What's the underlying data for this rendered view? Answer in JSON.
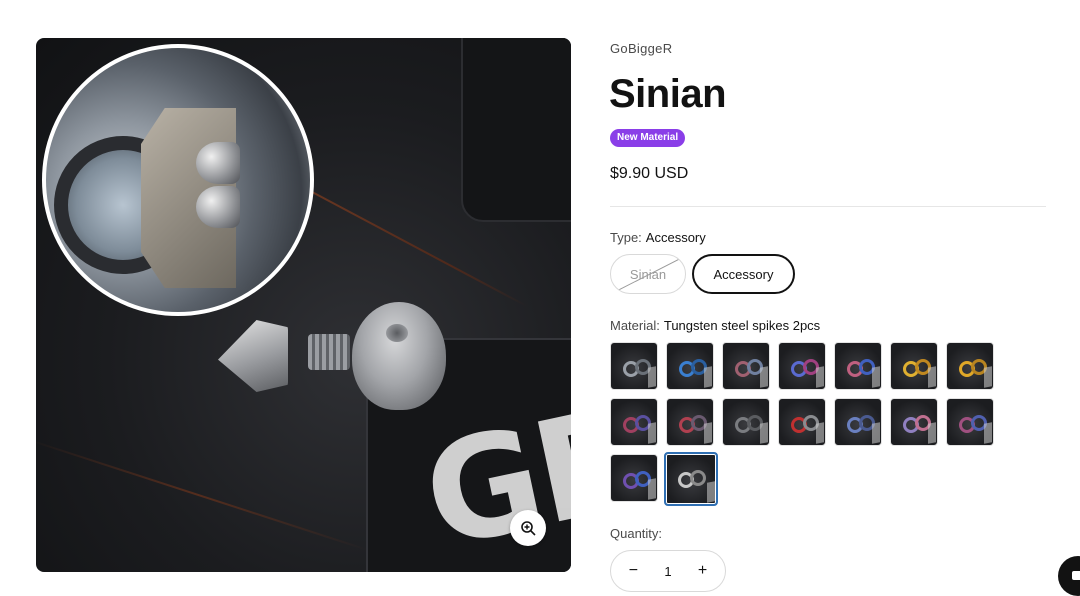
{
  "product": {
    "vendor": "GoBiggeR",
    "title": "Sinian",
    "badge": "New Material",
    "price": "$9.90 USD"
  },
  "options": {
    "type": {
      "label": "Type:",
      "selected": "Accessory",
      "values": [
        "Sinian",
        "Accessory"
      ],
      "unavailable": [
        "Sinian"
      ]
    },
    "material": {
      "label": "Material:",
      "selected": "Tungsten steel spikes 2pcs",
      "swatch_count": 16,
      "selected_index": 15
    }
  },
  "quantity": {
    "label": "Quantity:",
    "value": "1",
    "decrease_symbol": "−",
    "increase_symbol": "+"
  },
  "icons": {
    "zoom": "zoom-in-icon",
    "chat": "chat-icon"
  },
  "colors": {
    "badge": "#8a3ee8",
    "selected_swatch_border": "#2f6fb3",
    "text": "#121212"
  },
  "swatches": [
    {
      "ring": "#9aa0a8",
      "ring2": "#6a7078"
    },
    {
      "ring": "#3a7fd0",
      "ring2": "#2a5fa0"
    },
    {
      "ring": "#a06070",
      "ring2": "#7080a0"
    },
    {
      "ring": "#5a6ad0",
      "ring2": "#a04080"
    },
    {
      "ring": "#c06080",
      "ring2": "#4060c0"
    },
    {
      "ring": "#e0b030",
      "ring2": "#c08820"
    },
    {
      "ring": "#e0a828",
      "ring2": "#b88420"
    },
    {
      "ring": "#a04060",
      "ring2": "#5a50a0"
    },
    {
      "ring": "#b04050",
      "ring2": "#6a5a70"
    },
    {
      "ring": "#7a7c80",
      "ring2": "#5a5c60"
    },
    {
      "ring": "#c03030",
      "ring2": "#8a8c90"
    },
    {
      "ring": "#6a80c0",
      "ring2": "#4a5a90"
    },
    {
      "ring": "#9080c0",
      "ring2": "#c07090"
    },
    {
      "ring": "#a05080",
      "ring2": "#5060b0"
    },
    {
      "ring": "#7050b0",
      "ring2": "#4060c0"
    },
    {
      "ring": "#c8c8c8",
      "ring2": "#8a8a8a"
    }
  ]
}
